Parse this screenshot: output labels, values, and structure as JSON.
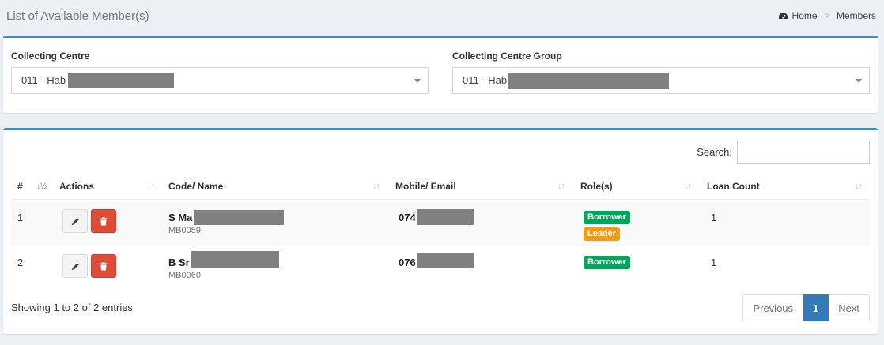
{
  "header": {
    "title": "List of Available Member(s)",
    "breadcrumb": {
      "home": "Home",
      "separator": ">",
      "current": "Members"
    }
  },
  "filters": {
    "collecting_centre": {
      "label": "Collecting Centre",
      "value": "011 - Hab"
    },
    "collecting_centre_group": {
      "label": "Collecting Centre Group",
      "value": "011 - Hab"
    }
  },
  "table": {
    "search_label": "Search:",
    "columns": [
      "#",
      "Actions",
      "Code/ Name",
      "Mobile/ Email",
      "Role(s)",
      "Loan Count"
    ],
    "rows": [
      {
        "index": "1",
        "name": "S Ma",
        "code": "MB0059",
        "mobile": "074",
        "roles": [
          "Borrower",
          "Leader"
        ],
        "loan_count": "1"
      },
      {
        "index": "2",
        "name": "B Sr",
        "code": "MB0060",
        "mobile": "076",
        "roles": [
          "Borrower"
        ],
        "loan_count": "1"
      }
    ],
    "info": "Showing 1 to 2 of 2 entries",
    "pagination": {
      "previous": "Previous",
      "current": "1",
      "next": "Next"
    }
  },
  "colors": {
    "accent": "#3c8dbc",
    "delete": "#dd4b39",
    "borrower_badge": "#00a65a",
    "leader_badge": "#f39c12",
    "pagination_active": "#337ab7"
  },
  "icons": {
    "home": "dashboard-icon",
    "edit": "pencil-icon",
    "delete": "trash-icon",
    "sort": "sort-icon",
    "sort_active": "sort-numeric-asc-icon"
  }
}
